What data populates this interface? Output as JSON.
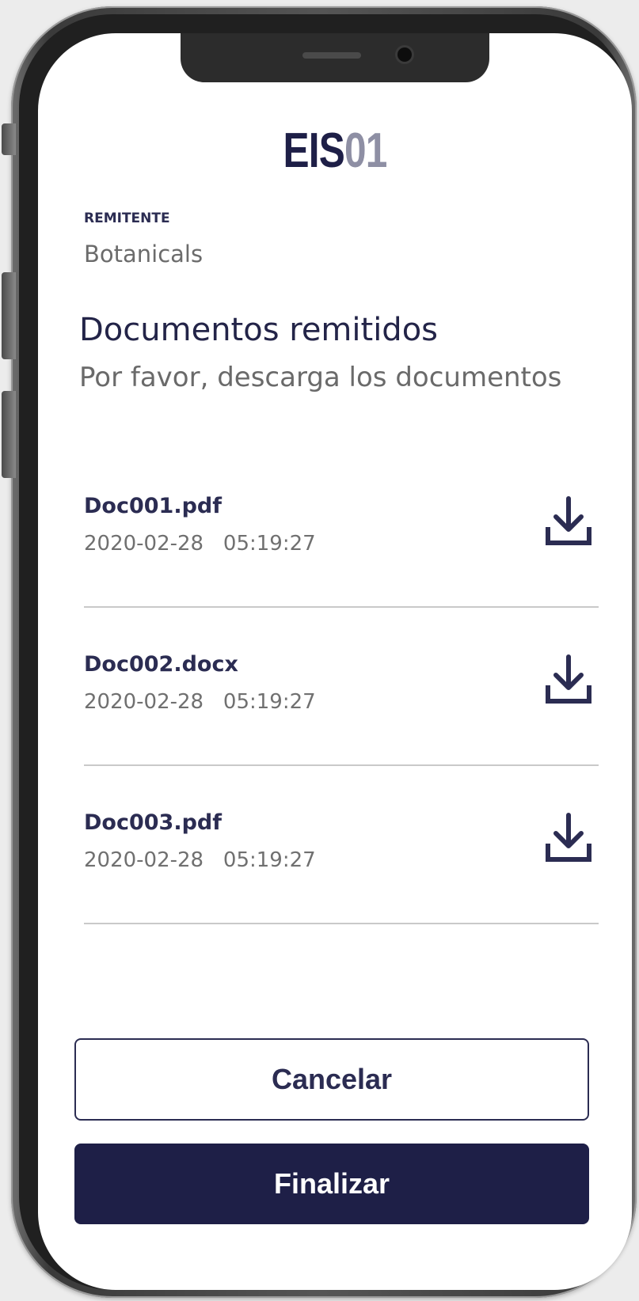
{
  "logo": {
    "part1": "EIS",
    "part2": "01"
  },
  "sender": {
    "label": "REMITENTE",
    "name": "Botanicals"
  },
  "section": {
    "title": "Documentos remitidos",
    "subtitle": "Por favor, descarga los documentos"
  },
  "documents": [
    {
      "name": "Doc001.pdf",
      "date": "2020-02-28",
      "time": "05:19:27",
      "icon": "download-icon"
    },
    {
      "name": "Doc002.docx",
      "date": "2020-02-28",
      "time": "05:19:27",
      "icon": "download-icon"
    },
    {
      "name": "Doc003.pdf",
      "date": "2020-02-28",
      "time": "05:19:27",
      "icon": "download-icon"
    }
  ],
  "buttons": {
    "cancel": "Cancelar",
    "finish": "Finalizar"
  },
  "colors": {
    "brand_navy": "#1e1f47",
    "brand_grey": "#8e8fa4",
    "text_muted": "#6b6b6b",
    "divider": "#c9c9c9"
  }
}
